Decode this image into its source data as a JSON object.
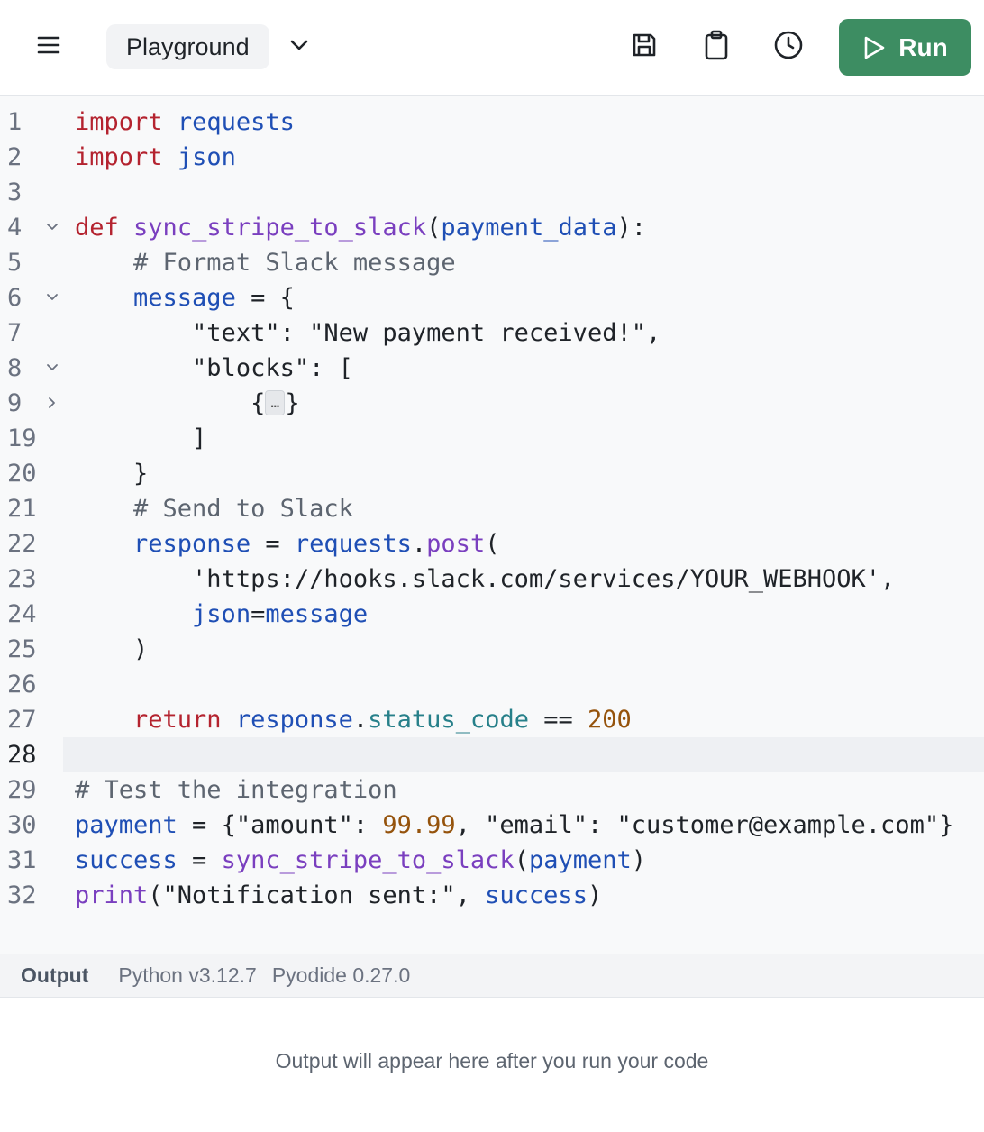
{
  "header": {
    "title": "Playground",
    "run_label": "Run",
    "icons": [
      "menu-icon",
      "chevron-down-icon",
      "save-icon",
      "clipboard-icon",
      "history-icon",
      "play-icon"
    ],
    "run_color": "#3d8d62"
  },
  "editor": {
    "active_line": "28",
    "lines": [
      {
        "n": "1",
        "tokens": [
          {
            "t": "import",
            "c": "kw"
          },
          {
            "t": " "
          },
          {
            "t": "requests",
            "c": "mod"
          }
        ]
      },
      {
        "n": "2",
        "tokens": [
          {
            "t": "import",
            "c": "kw"
          },
          {
            "t": " "
          },
          {
            "t": "json",
            "c": "mod"
          }
        ]
      },
      {
        "n": "3",
        "tokens": []
      },
      {
        "n": "4",
        "fold": "open",
        "tokens": [
          {
            "t": "def",
            "c": "kw"
          },
          {
            "t": " "
          },
          {
            "t": "sync_stripe_to_slack",
            "c": "fn"
          },
          {
            "t": "("
          },
          {
            "t": "payment_data",
            "c": "var"
          },
          {
            "t": "):"
          }
        ]
      },
      {
        "n": "5",
        "tokens": [
          {
            "t": "    "
          },
          {
            "t": "# Format Slack message",
            "c": "cmt"
          }
        ]
      },
      {
        "n": "6",
        "fold": "open",
        "tokens": [
          {
            "t": "    "
          },
          {
            "t": "message",
            "c": "var"
          },
          {
            "t": " = {"
          }
        ]
      },
      {
        "n": "7",
        "tokens": [
          {
            "t": "        "
          },
          {
            "t": "\"text\": \"New payment received!\",",
            "c": "str"
          }
        ]
      },
      {
        "n": "8",
        "fold": "open",
        "tokens": [
          {
            "t": "        "
          },
          {
            "t": "\"blocks\": [",
            "c": "str"
          }
        ]
      },
      {
        "n": "9",
        "fold": "closed",
        "tokens": [
          {
            "t": "            {"
          },
          {
            "t": "…",
            "c": "ph"
          },
          {
            "t": "}"
          }
        ]
      },
      {
        "n": "19",
        "tokens": [
          {
            "t": "        ]"
          }
        ]
      },
      {
        "n": "20",
        "tokens": [
          {
            "t": "    }"
          }
        ]
      },
      {
        "n": "21",
        "tokens": [
          {
            "t": "    "
          },
          {
            "t": "# Send to Slack",
            "c": "cmt"
          }
        ]
      },
      {
        "n": "22",
        "tokens": [
          {
            "t": "    "
          },
          {
            "t": "response",
            "c": "var"
          },
          {
            "t": " = "
          },
          {
            "t": "requests",
            "c": "var"
          },
          {
            "t": "."
          },
          {
            "t": "post",
            "c": "fn"
          },
          {
            "t": "("
          }
        ]
      },
      {
        "n": "23",
        "tokens": [
          {
            "t": "        "
          },
          {
            "t": "'https://hooks.slack.com/services/YOUR_WEBHOOK',",
            "c": "str"
          }
        ]
      },
      {
        "n": "24",
        "tokens": [
          {
            "t": "        "
          },
          {
            "t": "json",
            "c": "var"
          },
          {
            "t": "="
          },
          {
            "t": "message",
            "c": "var"
          }
        ]
      },
      {
        "n": "25",
        "tokens": [
          {
            "t": "    )"
          }
        ]
      },
      {
        "n": "26",
        "tokens": []
      },
      {
        "n": "27",
        "tokens": [
          {
            "t": "    "
          },
          {
            "t": "return",
            "c": "kw"
          },
          {
            "t": " "
          },
          {
            "t": "response",
            "c": "var"
          },
          {
            "t": "."
          },
          {
            "t": "status_code",
            "c": "attr"
          },
          {
            "t": " == "
          },
          {
            "t": "200",
            "c": "num"
          }
        ]
      },
      {
        "n": "28",
        "tokens": []
      },
      {
        "n": "29",
        "tokens": [
          {
            "t": "# Test the integration",
            "c": "cmt"
          }
        ]
      },
      {
        "n": "30",
        "tokens": [
          {
            "t": "payment",
            "c": "var"
          },
          {
            "t": " = {\"amount\": "
          },
          {
            "t": "99.99",
            "c": "num"
          },
          {
            "t": ", \"email\": \"customer@example.com\"}"
          }
        ]
      },
      {
        "n": "31",
        "tokens": [
          {
            "t": "success",
            "c": "var"
          },
          {
            "t": " = "
          },
          {
            "t": "sync_stripe_to_slack",
            "c": "fn"
          },
          {
            "t": "("
          },
          {
            "t": "payment",
            "c": "var"
          },
          {
            "t": ")"
          }
        ]
      },
      {
        "n": "32",
        "tokens": [
          {
            "t": "print",
            "c": "fn"
          },
          {
            "t": "(\"Notification sent:\", "
          },
          {
            "t": "success",
            "c": "var"
          },
          {
            "t": ")"
          }
        ]
      }
    ]
  },
  "output": {
    "label": "Output",
    "python_version": "Python v3.12.7",
    "pyodide_version": "Pyodide 0.27.0",
    "placeholder": "Output will appear here after you run your code"
  }
}
